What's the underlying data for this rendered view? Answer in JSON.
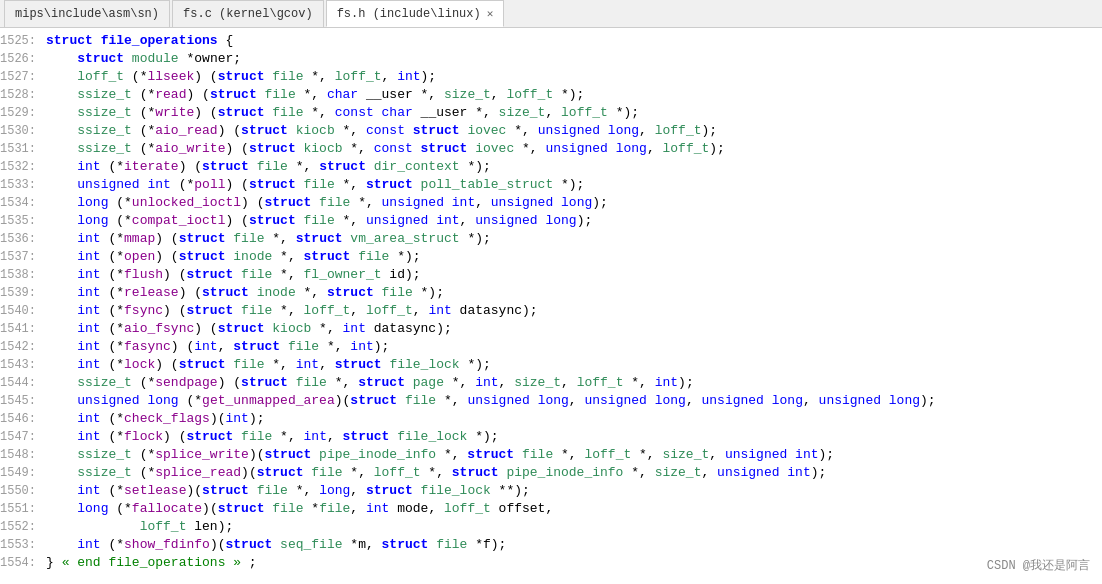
{
  "tabs": [
    {
      "id": "tab1",
      "label": "mips\\include\\asm\\sn)",
      "active": false,
      "closable": false
    },
    {
      "id": "tab2",
      "label": "fs.c (kernel\\gcov)",
      "active": false,
      "closable": false
    },
    {
      "id": "tab3",
      "label": "fs.h (include\\linux)",
      "active": true,
      "closable": true
    }
  ],
  "watermark": "CSDN @我还是阿言",
  "lines": [
    {
      "num": "1525:",
      "content": "struct file_operations {"
    },
    {
      "num": "1526:",
      "content": "    struct module *owner;"
    },
    {
      "num": "1527:",
      "content": "    loff_t (*llseek) (struct file *, loff_t, int);"
    },
    {
      "num": "1528:",
      "content": "    ssize_t (*read) (struct file *, char __user *, size_t, loff_t *);"
    },
    {
      "num": "1529:",
      "content": "    ssize_t (*write) (struct file *, const char __user *, size_t, loff_t *);"
    },
    {
      "num": "1530:",
      "content": "    ssize_t (*aio_read) (struct kiocb *, const struct iovec *, unsigned long, loff_t);"
    },
    {
      "num": "1531:",
      "content": "    ssize_t (*aio_write) (struct kiocb *, const struct iovec *, unsigned long, loff_t);"
    },
    {
      "num": "1532:",
      "content": "    int (*iterate) (struct file *, struct dir_context *);"
    },
    {
      "num": "1533:",
      "content": "    unsigned int (*poll) (struct file *, struct poll_table_struct *);"
    },
    {
      "num": "1534:",
      "content": "    long (*unlocked_ioctl) (struct file *, unsigned int, unsigned long);"
    },
    {
      "num": "1535:",
      "content": "    long (*compat_ioctl) (struct file *, unsigned int, unsigned long);"
    },
    {
      "num": "1536:",
      "content": "    int (*mmap) (struct file *, struct vm_area_struct *);"
    },
    {
      "num": "1537:",
      "content": "    int (*open) (struct inode *, struct file *);"
    },
    {
      "num": "1538:",
      "content": "    int (*flush) (struct file *, fl_owner_t id);"
    },
    {
      "num": "1539:",
      "content": "    int (*release) (struct inode *, struct file *);"
    },
    {
      "num": "1540:",
      "content": "    int (*fsync) (struct file *, loff_t, loff_t, int datasync);"
    },
    {
      "num": "1541:",
      "content": "    int (*aio_fsync) (struct kiocb *, int datasync);"
    },
    {
      "num": "1542:",
      "content": "    int (*fasync) (int, struct file *, int);"
    },
    {
      "num": "1543:",
      "content": "    int (*lock) (struct file *, int, struct file_lock *);"
    },
    {
      "num": "1544:",
      "content": "    ssize_t (*sendpage) (struct file *, struct page *, int, size_t, loff_t *, int);"
    },
    {
      "num": "1545:",
      "content": "    unsigned long (*get_unmapped_area)(struct file *, unsigned long, unsigned long, unsigned long, unsigned long);"
    },
    {
      "num": "1546:",
      "content": "    int (*check_flags)(int);"
    },
    {
      "num": "1547:",
      "content": "    int (*flock) (struct file *, int, struct file_lock *);"
    },
    {
      "num": "1548:",
      "content": "    ssize_t (*splice_write)(struct pipe_inode_info *, struct file *, loff_t *, size_t, unsigned int);"
    },
    {
      "num": "1549:",
      "content": "    ssize_t (*splice_read)(struct file *, loff_t *, struct pipe_inode_info *, size_t, unsigned int);"
    },
    {
      "num": "1550:",
      "content": "    int (*setlease)(struct file *, long, struct file_lock **);"
    },
    {
      "num": "1551:",
      "content": "    long (*fallocate)(struct file *file, int mode, loff_t offset,"
    },
    {
      "num": "1552:",
      "content": "            loff_t len);"
    },
    {
      "num": "1553:",
      "content": "    int (*show_fdinfo)(struct seq_file *m, struct file *f);"
    },
    {
      "num": "1554:",
      "content": "} « end file_operations » ;"
    }
  ]
}
